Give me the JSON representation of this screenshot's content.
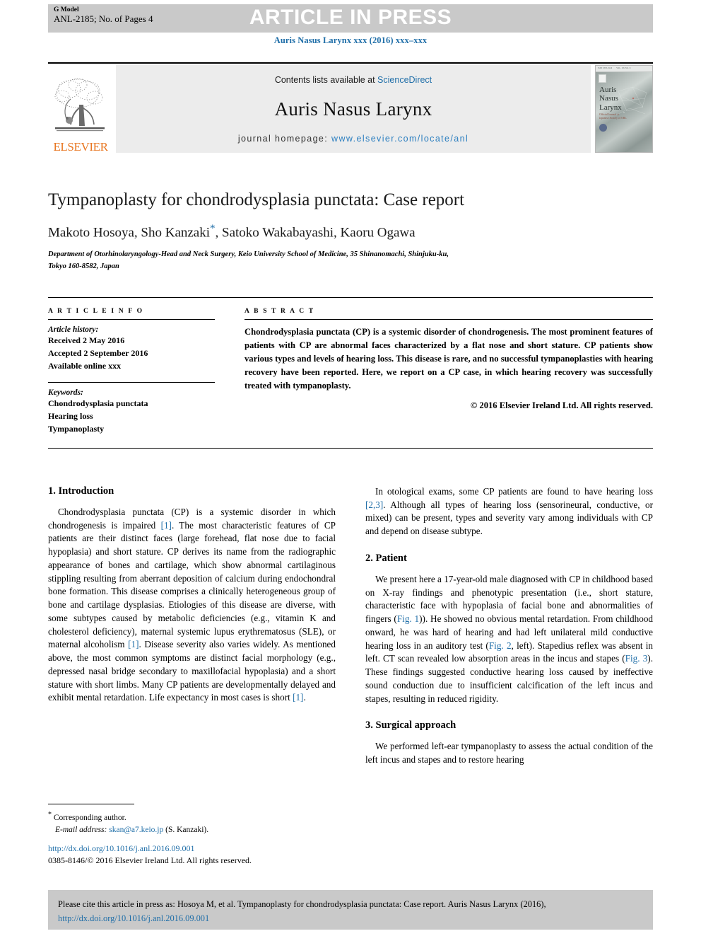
{
  "header": {
    "g_model_label": "G Model",
    "manuscript_id": "ANL-2185; No. of Pages 4",
    "press_banner": "ARTICLE IN PRESS",
    "journal_ref": "Auris Nasus Larynx xxx (2016) xxx–xxx"
  },
  "masthead": {
    "publisher": "ELSEVIER",
    "contents_prefix": "Contents lists available at ",
    "contents_link": "ScienceDirect",
    "journal_name": "Auris Nasus Larynx",
    "homepage_prefix": "journal homepage: ",
    "homepage_url": "www.elsevier.com/locate/anl",
    "cover": {
      "title_line1": "Auris",
      "title_line2": "Nasus",
      "title_line3": "Larynx",
      "subtitle": "Official Journal of\nJapanese Society of ORL"
    }
  },
  "article": {
    "title": "Tympanoplasty for chondrodysplasia punctata: Case report",
    "authors_pre": "Makoto Hosoya, Sho Kanzaki",
    "author_star": "*",
    "authors_post": ", Satoko Wakabayashi, Kaoru Ogawa",
    "affiliation_line1": "Department of Otorhinolaryngology-Head and Neck Surgery, Keio University School of Medicine, 35 Shinanomachi, Shinjuku-ku,",
    "affiliation_line2": "Tokyo 160-8582, Japan"
  },
  "article_info": {
    "heading": "A R T I C L E   I N F O",
    "history_label": "Article history:",
    "history": [
      "Received 2 May 2016",
      "Accepted 2 September 2016",
      "Available online xxx"
    ],
    "keywords_label": "Keywords:",
    "keywords": [
      "Chondrodysplasia punctata",
      "Hearing loss",
      "Tympanoplasty"
    ]
  },
  "abstract": {
    "heading": "A B S T R A C T",
    "text": "Chondrodysplasia punctata (CP) is a systemic disorder of chondrogenesis. The most prominent features of patients with CP are abnormal faces characterized by a flat nose and short stature. CP patients show various types and levels of hearing loss. This disease is rare, and no successful tympanoplasties with hearing recovery have been reported. Here, we report on a CP case, in which hearing recovery was successfully treated with tympanoplasty.",
    "copyright": "© 2016 Elsevier Ireland Ltd. All rights reserved."
  },
  "body": {
    "left_column": {
      "section1_heading": "1. Introduction",
      "p1_a": "Chondrodysplasia punctata (CP) is a systemic disorder in which chondrogenesis is impaired ",
      "p1_ref1": "[1]",
      "p1_b": ". The most characteristic features of CP patients are their distinct faces (large forehead, flat nose due to facial hypoplasia) and short stature. CP derives its name from the radiographic appearance of bones and cartilage, which show abnormal cartilaginous stippling resulting from aberrant deposition of calcium during endochondral bone formation. This disease comprises a clinically heterogeneous group of bone and cartilage dysplasias. Etiologies of this disease are diverse, with some subtypes caused by metabolic deficiencies (e.g., vitamin K and cholesterol deficiency), maternal systemic lupus erythrematosus (SLE), or maternal alcoholism ",
      "p1_ref2": "[1]",
      "p1_c": ". Disease severity also varies widely. As mentioned above, the most common symptoms are distinct facial morphology (e.g., depressed nasal bridge secondary to maxillofacial hypoplasia) and a short stature with short limbs. Many CP patients are developmentally delayed and exhibit mental retardation. Life expectancy in most cases is short ",
      "p1_ref3": "[1]",
      "p1_d": "."
    },
    "right_column": {
      "p1_a": "In otological exams, some CP patients are found to have hearing loss ",
      "p1_ref1": "[2,3]",
      "p1_b": ". Although all types of hearing loss (sensorineural, conductive, or mixed) can be present, types and severity vary among individuals with CP and depend on disease subtype.",
      "section2_heading": "2. Patient",
      "p2_a": "We present here a 17-year-old male diagnosed with CP in childhood based on X-ray findings and phenotypic presentation (i.e., short stature, characteristic face with hypoplasia of facial bone and abnormalities of fingers (",
      "p2_fig1": "Fig. 1",
      "p2_b": ")). He showed no obvious mental retardation. From childhood onward, he was hard of hearing and had left unilateral mild conductive hearing loss in an auditory test (",
      "p2_fig2": "Fig. 2",
      "p2_c": ", left). Stapedius reflex was absent in left. CT scan revealed low absorption areas in the incus and stapes (",
      "p2_fig3": "Fig. 3",
      "p2_d": "). These findings suggested conductive hearing loss caused by ineffective sound conduction due to insufficient calcification of the left incus and stapes, resulting in reduced rigidity.",
      "section3_heading": "3. Surgical approach",
      "p3": "We performed left-ear tympanoplasty to assess the actual condition of the left incus and stapes and to restore hearing"
    }
  },
  "footnote": {
    "corresponding_star": "*",
    "corresponding_text": " Corresponding author.",
    "email_label": "E-mail address:",
    "email": "skan@a7.keio.jp",
    "email_owner": "(S. Kanzaki).",
    "doi_url": "http://dx.doi.org/10.1016/j.anl.2016.09.001",
    "issn_line": "0385-8146/© 2016 Elsevier Ireland Ltd. All rights reserved."
  },
  "cite_box": {
    "text": "Please cite this article in press as: Hosoya M, et al. Tympanoplasty for chondrodysplasia punctata: Case report. Auris Nasus Larynx (2016),",
    "doi": "http://dx.doi.org/10.1016/j.anl.2016.09.001"
  },
  "colors": {
    "link_blue": "#1f6ea8",
    "homepage_blue": "#2c7fc0",
    "elsevier_orange": "#e87722",
    "band_gray": "#c9c9c9",
    "mast_gray": "#ececec"
  }
}
